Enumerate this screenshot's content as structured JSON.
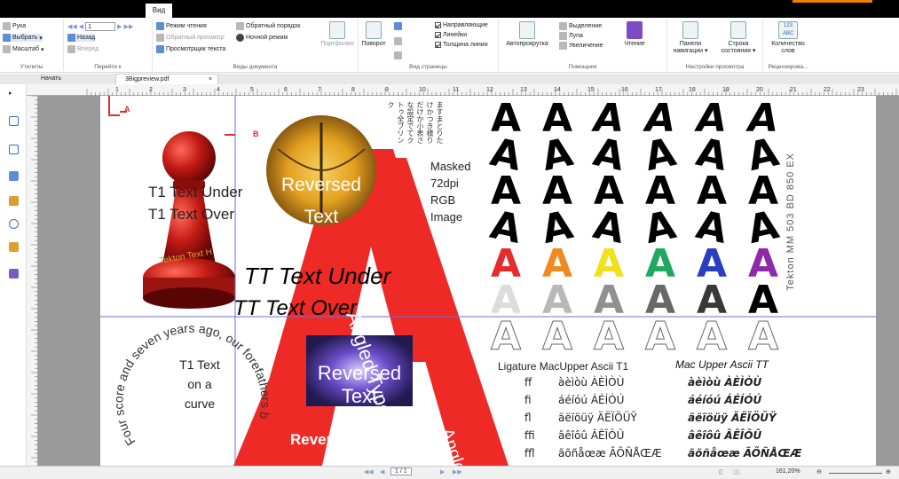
{
  "ribbon_tab": "Вид",
  "ribbon": {
    "tools": {
      "hand": "Рука",
      "select": "Выбрать",
      "zoom": "Масштаб",
      "label": "Утилиты"
    },
    "goto": {
      "back": "Назад",
      "forward": "Вперед",
      "page_value": "1",
      "label": "Перейти к"
    },
    "docviews": {
      "read_mode": "Режим чтения",
      "reverse_view": "Обратный просмотр",
      "text_viewer": "Просмотрщик текста",
      "reverse_order": "Обратный порядок",
      "night_mode": "Ночной режим",
      "portfolio": "Портфолио",
      "label": "Виды документа"
    },
    "pageview": {
      "rotate": "Поворот",
      "guides": "Направляющие",
      "rulers": "Линейки",
      "line_weights": "Толщина линии",
      "label": "Вид страницы"
    },
    "assistant": {
      "autoscroll": "Автопрокрутка",
      "marquee": "Выделение",
      "loupe": "Лупа",
      "magnifier": "Увеличение",
      "read": "Чтение",
      "label": "Помощник"
    },
    "viewsettings": {
      "nav_panels_line1": "Панели",
      "nav_panels_line2": "навигации ▾",
      "status_bar_line1": "Строка",
      "status_bar_line2": "состояния ▾",
      "label": "Настройки просмотра"
    },
    "review": {
      "icon_text": "123 ABC",
      "word_count_line1": "Количество",
      "word_count_line2": "слов",
      "label": "Рецензирова..."
    }
  },
  "doc_tabs": [
    "Начать",
    "3Bigpreview.pdf"
  ],
  "ruler_marks": [
    "1",
    "2",
    "3",
    "4",
    "5",
    "6",
    "7",
    "8",
    "9",
    "10",
    "11",
    "12",
    "13",
    "14",
    "15",
    "16",
    "17",
    "18",
    "19",
    "20",
    "21",
    "22",
    "23"
  ],
  "page_content": {
    "marker_a": "A",
    "marker_b": "B",
    "t1_under": "T1 Text Under",
    "t1_over": "T1 Text Over",
    "tekton_text": "Tekton Text H",
    "tt_under": "TT Text Under",
    "tt_over": "TT Text Over",
    "reversed_text_1": "Reversed Text",
    "reversed_text_2": "Reversed Text",
    "reversed_text_3": "Reversed Text",
    "masked": [
      "Masked",
      "72dpi",
      "RGB",
      "Image"
    ],
    "angled_1": "Angled Type1",
    "angled_2": "Angled",
    "spiral_text": "Four score and seven years ago, our forefathers brought forth... This is a test of text on a spiral This is",
    "curve_text": [
      "T1 Text",
      "on a",
      "curve"
    ],
    "tekton_vertical": "Tekton MM 503 BD 850 EX",
    "japanese_vertical": "ますまとりたけかつき様りだけか小表さな設定でてクトゥ全ブリンク",
    "big_a_glyph": "A",
    "ligature_header": "Ligature MacUpper Ascii T1",
    "mac_header": "Mac Upper Ascii TT",
    "ligature_rows": [
      {
        "lig": "ff",
        "t1": "àèìòù ÀÈÌÒÙ",
        "tt": "àèìòù ÀÈÌÒÙ"
      },
      {
        "lig": "fi",
        "t1": "áéíóú ÁÉÍÓÚ",
        "tt": "áéíóú ÁÉÍÓÚ"
      },
      {
        "lig": "fl",
        "t1": "äëïöüÿ ÄËÏÖÜŸ",
        "tt": "äëïöüÿ ÄËÏÖÜŸ"
      },
      {
        "lig": "ffi",
        "t1": "âêîôû ÂÊÎÔÛ",
        "tt": "âêîôû ÂÊÎÔÛ"
      },
      {
        "lig": "ffl",
        "t1": "ãõñåœæ ÃÕÑÅŒÆ",
        "tt": "ãõñåœæ ÃÕÑÅŒÆ"
      }
    ]
  },
  "status": {
    "page": "1 / 1",
    "zoom": "161,20%"
  },
  "colors": {
    "red": "#e62b2b",
    "pawn": "#b81818",
    "guide": "#6f6fd8",
    "accent": "#f08000"
  }
}
